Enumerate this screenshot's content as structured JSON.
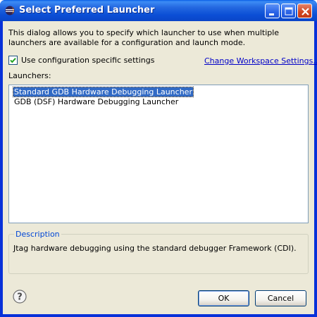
{
  "window": {
    "title": "Select Preferred Launcher"
  },
  "dialog": {
    "intro": "This dialog allows you to specify which launcher to use when multiple launchers are available for a configuration and launch mode.",
    "checkbox_label": "Use configuration specific settings",
    "checkbox_checked": true,
    "workspace_link": "Change Workspace Settings...",
    "launchers_label": "Launchers:",
    "launchers": [
      {
        "label": "Standard GDB Hardware Debugging Launcher",
        "selected": true
      },
      {
        "label": "GDB (DSF) Hardware Debugging Launcher",
        "selected": false
      }
    ],
    "description_title": "Description",
    "description_text": "Jtag hardware debugging using the standard debugger Framework (CDI)."
  },
  "buttons": {
    "ok": "OK",
    "cancel": "Cancel"
  },
  "icons": {
    "app": "eclipse-icon",
    "minimize": "minimize-icon",
    "maximize": "maximize-icon",
    "close": "close-icon",
    "help": "help-icon",
    "check": "check-icon"
  },
  "colors": {
    "titlebar": "#0b4fd6",
    "dialog_bg": "#ece9d8",
    "selection": "#316ac5",
    "link": "#0000c8",
    "group_title": "#0046d5"
  }
}
